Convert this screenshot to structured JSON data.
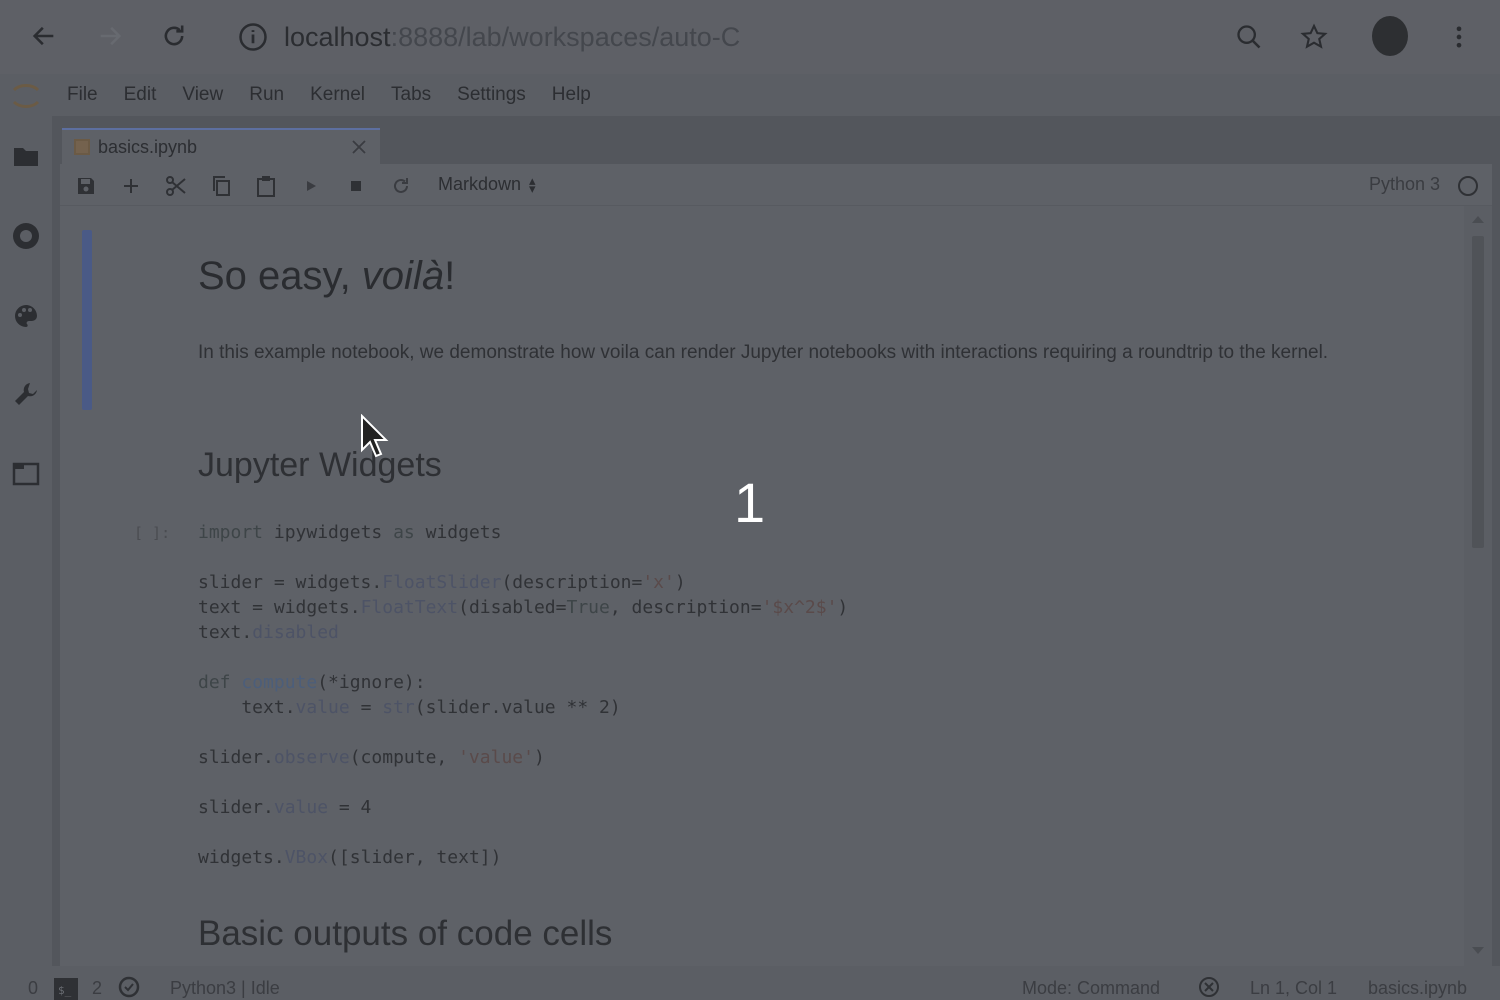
{
  "browser": {
    "url_host": "localhost",
    "url_path": ":8888/lab/workspaces/auto-C"
  },
  "menu": {
    "items": [
      "File",
      "Edit",
      "View",
      "Run",
      "Kernel",
      "Tabs",
      "Settings",
      "Help"
    ]
  },
  "tab": {
    "label": "basics.ipynb"
  },
  "toolbar": {
    "cell_type": "Markdown",
    "kernel_name": "Python 3"
  },
  "notebook": {
    "title_plain": "So easy, ",
    "title_italic": "voilà",
    "title_end": "!",
    "intro": "In this example notebook, we demonstrate how voila can render Jupyter notebooks with interactions requiring a roundtrip to the kernel.",
    "section1": "Jupyter Widgets",
    "prompt": "[ ]:",
    "section2": "Basic outputs of code cells"
  },
  "status": {
    "zero": "0",
    "two": "2",
    "kernel_state": "Python3 | Idle",
    "mode": "Mode: Command",
    "position": "Ln 1, Col 1",
    "file": "basics.ipynb"
  },
  "overlay": {
    "number": "1"
  },
  "icons": {
    "back": "arrow-left-icon",
    "forward": "arrow-right-icon",
    "reload": "reload-icon",
    "info": "info-icon",
    "search": "search-icon",
    "star": "star-icon",
    "more": "more-vert-icon"
  }
}
